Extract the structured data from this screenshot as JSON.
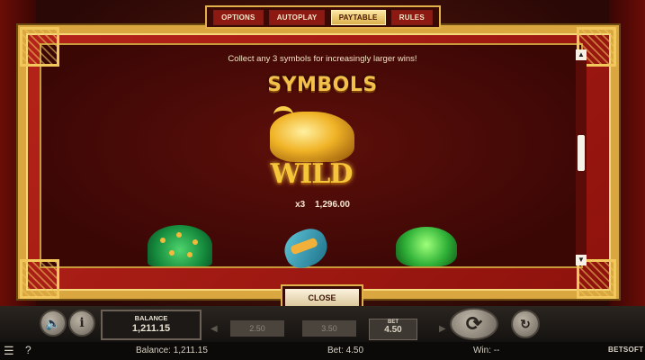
{
  "tabs": [
    "OPTIONS",
    "AUTOPLAY",
    "PAYTABLE",
    "RULES"
  ],
  "active_tab": "PAYTABLE",
  "paytable": {
    "intro": "Collect any 3 symbols for increasingly larger wins!",
    "section_title": "SYMBOLS",
    "wild_label": "WILD",
    "wild_multiplier": "x3",
    "wild_payout": "1,296.00"
  },
  "close_label": "CLOSE",
  "hud": {
    "balance_label": "BALANCE",
    "balance_value": "1,211.15",
    "bet_options": [
      "2.50",
      "3.50"
    ],
    "bet_label": "BET",
    "bet_value": "4.50"
  },
  "status": {
    "balance": "Balance: 1,211.15",
    "bet": "Bet: 4.50",
    "win": "Win: --",
    "logo": "BETSOFT"
  },
  "colors": {
    "gold": "#d9a640",
    "frame_red": "#a81c14",
    "text_cream": "#f3e2c4"
  }
}
